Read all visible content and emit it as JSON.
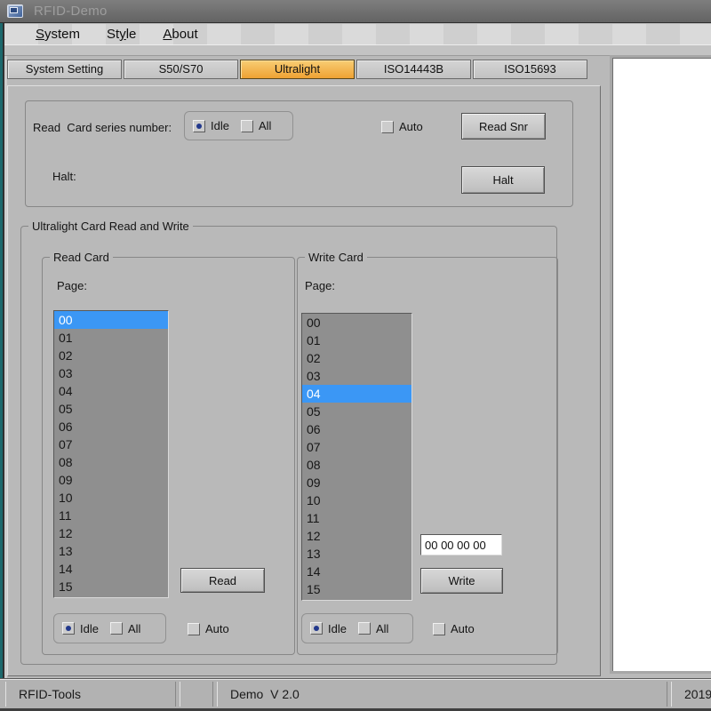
{
  "window": {
    "title": "RFID-Demo"
  },
  "menu": {
    "items": [
      {
        "label": "System",
        "pre": "",
        "accel": "S",
        "post": "ystem"
      },
      {
        "label": "Style",
        "pre": "St",
        "accel": "y",
        "post": "le"
      },
      {
        "label": "About",
        "pre": "",
        "accel": "A",
        "post": "bout"
      }
    ]
  },
  "tabs": [
    {
      "label": "System Setting",
      "active": false
    },
    {
      "label": "S50/S70",
      "active": false
    },
    {
      "label": "Ultralight",
      "active": true
    },
    {
      "label": "ISO14443B",
      "active": false
    },
    {
      "label": "ISO15693",
      "active": false
    }
  ],
  "snr_panel": {
    "read_label": "Read  Card series number:",
    "radio_idle": "Idle",
    "radio_all": "All",
    "idle_selected": true,
    "auto_label": "Auto",
    "auto_checked": false,
    "read_snr_button": "Read Snr",
    "halt_label": "Halt:",
    "halt_button": "Halt"
  },
  "ultralight_group": {
    "title": "Ultralight Card Read and Write",
    "read_card": {
      "title": "Read Card",
      "page_label": "Page:",
      "pages": [
        "00",
        "01",
        "02",
        "03",
        "04",
        "05",
        "06",
        "07",
        "08",
        "09",
        "10",
        "11",
        "12",
        "13",
        "14",
        "15"
      ],
      "selected_page": "00",
      "read_button": "Read",
      "radio_idle": "Idle",
      "radio_all": "All",
      "idle_selected": true,
      "auto_label": "Auto",
      "auto_checked": false
    },
    "write_card": {
      "title": "Write Card",
      "page_label": "Page:",
      "pages": [
        "00",
        "01",
        "02",
        "03",
        "04",
        "05",
        "06",
        "07",
        "08",
        "09",
        "10",
        "11",
        "12",
        "13",
        "14",
        "15"
      ],
      "selected_page": "04",
      "write_value": "00 00 00 00",
      "write_button": "Write",
      "radio_idle": "Idle",
      "radio_all": "All",
      "idle_selected": true,
      "auto_label": "Auto",
      "auto_checked": false
    }
  },
  "status_bar": {
    "segments": [
      "RFID-Tools",
      "",
      "Demo  V 2.0",
      "2019"
    ]
  },
  "colors": {
    "active_tab": "#efa233",
    "selection": "#3b97f5",
    "list_bg": "#8f8f8f",
    "radio_dot": "#22388c",
    "titlebar": "#6a6a6a",
    "window_bg": "#b9b9b9"
  }
}
